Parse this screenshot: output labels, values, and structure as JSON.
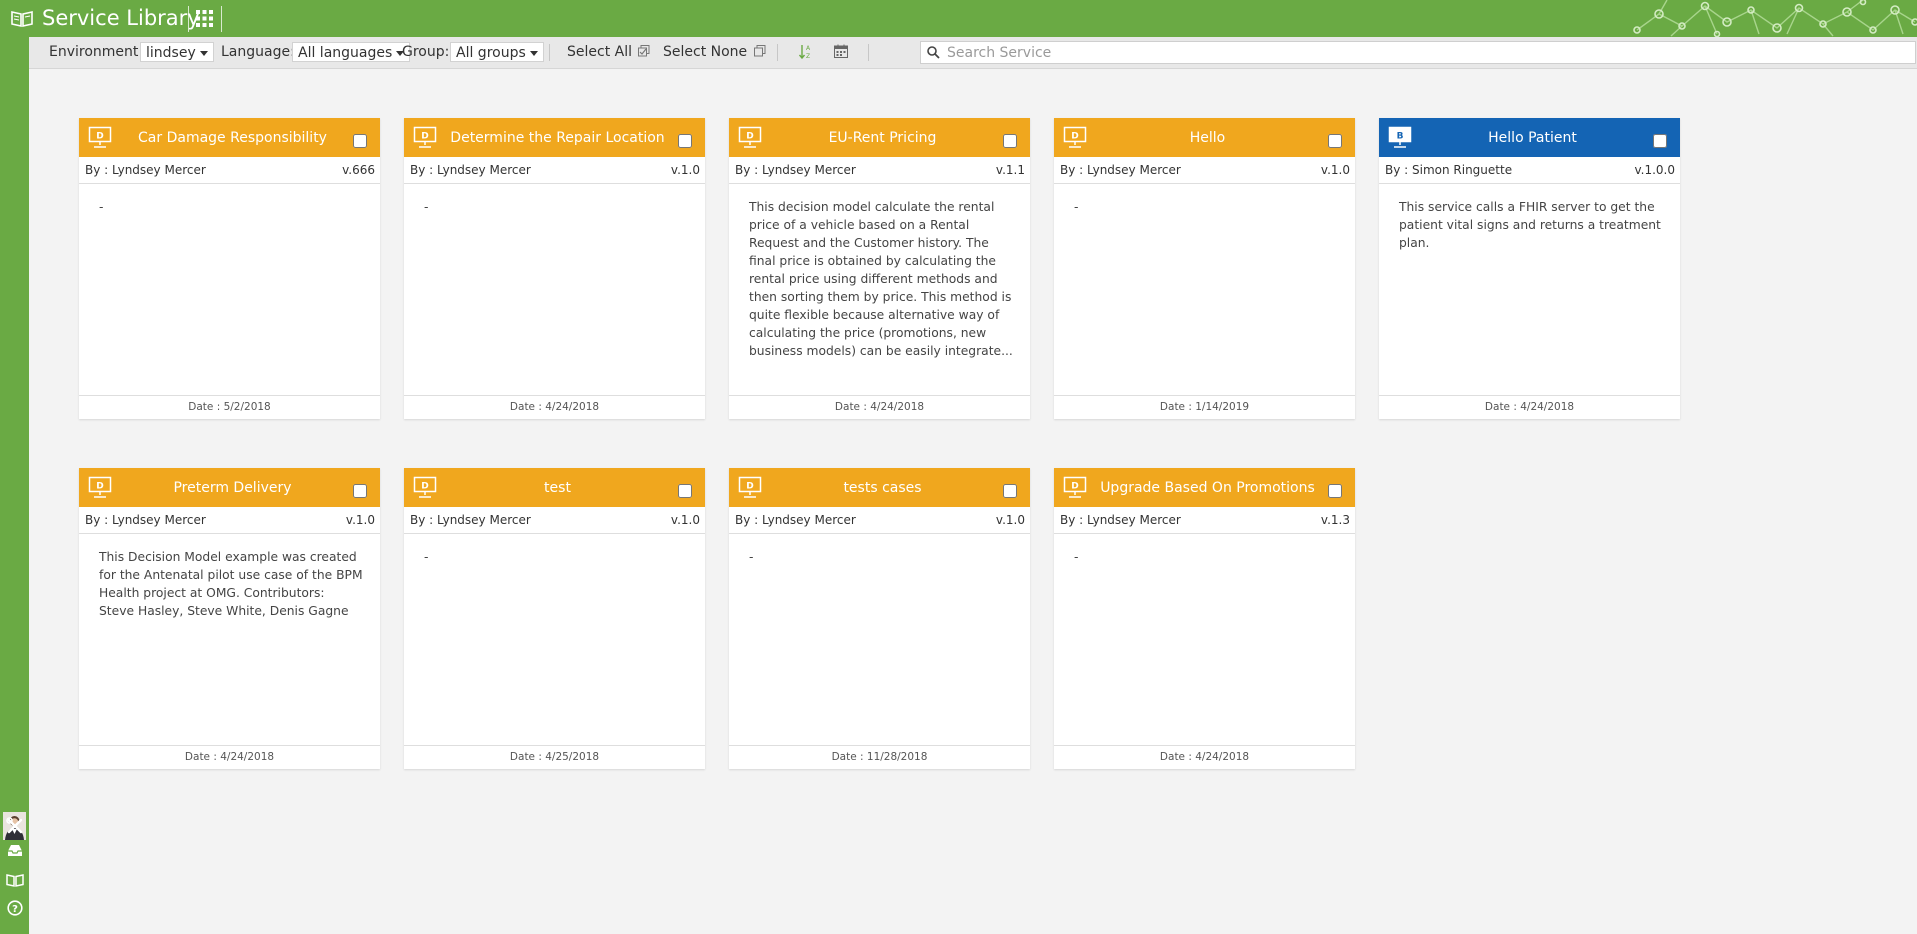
{
  "app": {
    "title": "Service Library"
  },
  "colors": {
    "brand_green": "#6aaa44",
    "card_orange": "#f0a71e",
    "card_blue": "#1464b4"
  },
  "toolbar": {
    "environment_label": "Environment:",
    "environment_value": "lindsey",
    "language_label": "Language:",
    "language_value": "All languages",
    "group_label": "Group:",
    "group_value": "All groups",
    "select_all": "Select All",
    "select_none": "Select None",
    "search_placeholder": "Search Service"
  },
  "rail": {
    "icons": [
      "user-avatar",
      "tools-icon",
      "inbox-icon",
      "library-book-icon",
      "help-icon"
    ]
  },
  "cards": [
    {
      "name": "Car Damage Responsibility",
      "by": "By :  Lyndsey Mercer",
      "version": "v.666",
      "description": "-",
      "date": "Date :  5/2/2018",
      "icon_letter": "D",
      "color": "orange"
    },
    {
      "name": "Determine the Repair Location",
      "by": "By :  Lyndsey Mercer",
      "version": "v.1.0",
      "description": "-",
      "date": "Date :  4/24/2018",
      "icon_letter": "D",
      "color": "orange"
    },
    {
      "name": "EU-Rent Pricing",
      "by": "By :  Lyndsey Mercer",
      "version": "v.1.1",
      "description": "This decision model calculate the rental price of a vehicle based on a Rental Request and the Customer history.  The final price is obtained by calculating the rental price using different methods and then sorting them by price. This method is quite flexible because alternative way of calculating the price (promotions, new business models) can be easily integrate...",
      "date": "Date :  4/24/2018",
      "icon_letter": "D",
      "color": "orange"
    },
    {
      "name": "Hello",
      "by": "By :  Lyndsey Mercer",
      "version": "v.1.0",
      "description": "-",
      "date": "Date :  1/14/2019",
      "icon_letter": "D",
      "color": "orange"
    },
    {
      "name": "Hello Patient",
      "by": "By :  Simon Ringuette",
      "version": "v.1.0.0",
      "description": "This service calls a FHIR server to get the patient vital signs and returns a treatment plan.",
      "date": "Date :  4/24/2018",
      "icon_letter": "B",
      "color": "blue"
    },
    {
      "name": "Preterm Delivery",
      "by": "By :  Lyndsey Mercer",
      "version": "v.1.0",
      "description": "This Decision Model example was created for the Antenatal pilot use case of the BPM Health project at OMG. Contributors: Steve Hasley, Steve White, Denis Gagne",
      "date": "Date :  4/24/2018",
      "icon_letter": "D",
      "color": "orange"
    },
    {
      "name": "test",
      "by": "By :  Lyndsey Mercer",
      "version": "v.1.0",
      "description": "-",
      "date": "Date :  4/25/2018",
      "icon_letter": "D",
      "color": "orange"
    },
    {
      "name": "tests cases",
      "by": "By :  Lyndsey Mercer",
      "version": "v.1.0",
      "description": "-",
      "date": "Date :  11/28/2018",
      "icon_letter": "D",
      "color": "orange"
    },
    {
      "name": "Upgrade Based On Promotions",
      "by": "By :  Lyndsey Mercer",
      "version": "v.1.3",
      "description": "-",
      "date": "Date :  4/24/2018",
      "icon_letter": "D",
      "color": "orange"
    }
  ]
}
